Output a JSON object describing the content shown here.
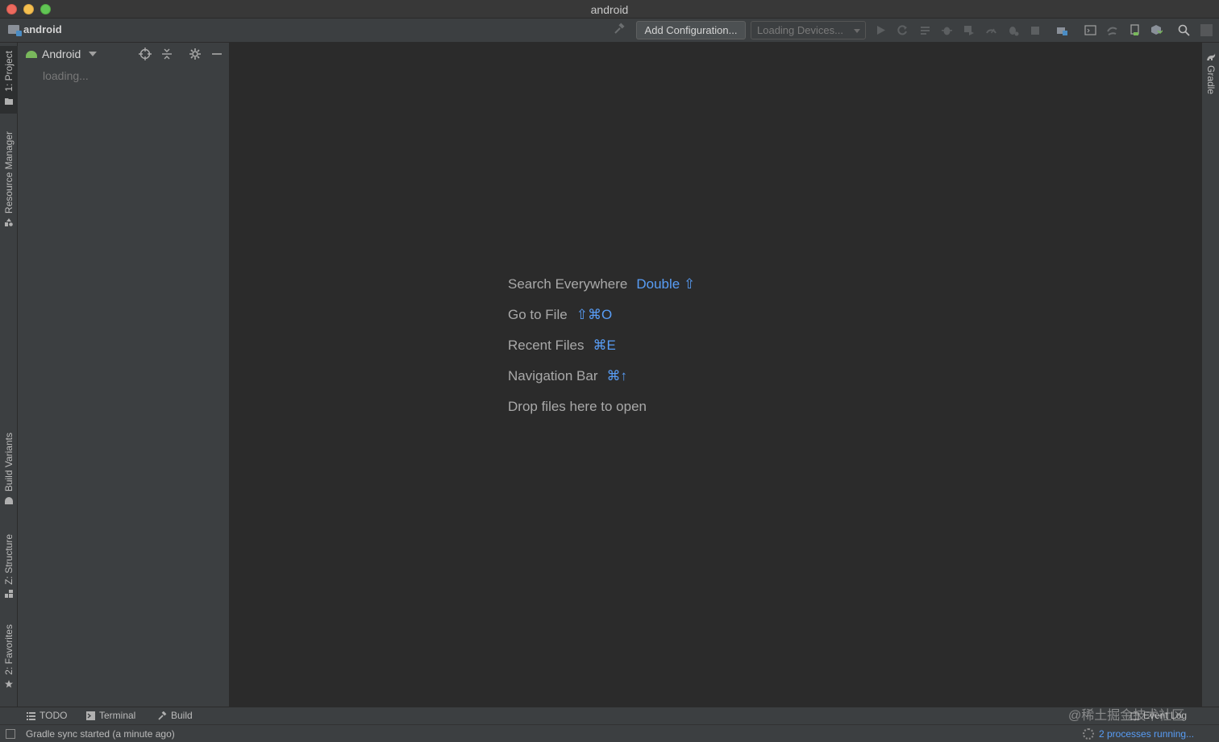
{
  "window": {
    "title": "android"
  },
  "navbar": {
    "project_name": "android",
    "add_configuration_label": "Add Configuration...",
    "devices_placeholder": "Loading Devices..."
  },
  "project_panel": {
    "view_mode": "Android",
    "loading_text": "loading..."
  },
  "left_strip": {
    "tabs": [
      "1: Project",
      "Resource Manager",
      "Build Variants",
      "Z: Structure",
      "2: Favorites"
    ]
  },
  "right_strip": {
    "tabs": [
      "Gradle"
    ]
  },
  "editor": {
    "hints": [
      {
        "label": "Search Everywhere",
        "shortcut": "Double ⇧"
      },
      {
        "label": "Go to File",
        "shortcut": "⇧⌘O"
      },
      {
        "label": "Recent Files",
        "shortcut": "⌘E"
      },
      {
        "label": "Navigation Bar",
        "shortcut": "⌘↑"
      },
      {
        "label": "Drop files here to open",
        "shortcut": ""
      }
    ]
  },
  "bottom_tabs": {
    "todo": "TODO",
    "terminal": "Terminal",
    "build": "Build",
    "event_log": "Event Log"
  },
  "status_bar": {
    "message": "Gradle sync started (a minute ago)",
    "processes": "2 processes running..."
  },
  "watermark": "@稀土掘金技术社区",
  "colors": {
    "accent_link": "#589df6",
    "android_green": "#79b85c",
    "editor_bg": "#2b2b2b",
    "panel_bg": "#3c3f41"
  }
}
